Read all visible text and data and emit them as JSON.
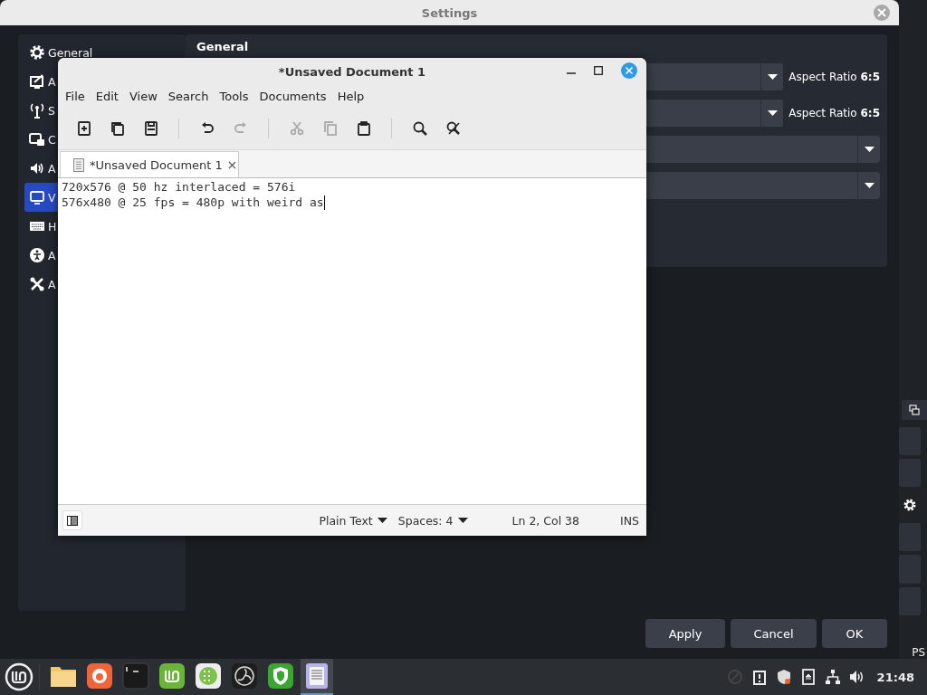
{
  "settings_window": {
    "title": "Settings",
    "sidebar": [
      {
        "label": "General",
        "kind": "gear",
        "selected": false
      },
      {
        "label": "A",
        "kind": "appearance",
        "selected": false
      },
      {
        "label": "S",
        "kind": "antenna",
        "selected": false
      },
      {
        "label": "C",
        "kind": "output",
        "selected": false
      },
      {
        "label": "A",
        "kind": "audio",
        "selected": false
      },
      {
        "label": "V",
        "kind": "monitor",
        "selected": true
      },
      {
        "label": "H",
        "kind": "keyboard",
        "selected": false
      },
      {
        "label": "A",
        "kind": "accessibility",
        "selected": false
      },
      {
        "label": "A",
        "kind": "tools",
        "selected": false
      }
    ],
    "heading": "General",
    "dropdowns": [
      {
        "kind": "short",
        "aside": "Aspect Ratio **6:5**"
      },
      {
        "kind": "short",
        "aside": "Aspect Ratio **6:5**"
      },
      {
        "kind": "wide"
      },
      {
        "kind": "wide"
      }
    ],
    "buttons": [
      "Apply",
      "Cancel",
      "OK"
    ]
  },
  "background_window": {
    "status_text": "PS"
  },
  "editor_window": {
    "title": "*Unsaved Document 1",
    "menu": [
      "File",
      "Edit",
      "View",
      "Search",
      "Tools",
      "Documents",
      "Help"
    ],
    "toolbar": [
      {
        "kind": "new",
        "disabled": false
      },
      {
        "kind": "open",
        "disabled": false
      },
      {
        "kind": "save",
        "disabled": false
      },
      {
        "kind": "sep"
      },
      {
        "kind": "undo",
        "disabled": false
      },
      {
        "kind": "redo",
        "disabled": true
      },
      {
        "kind": "sep"
      },
      {
        "kind": "cut",
        "disabled": true
      },
      {
        "kind": "copy",
        "disabled": true
      },
      {
        "kind": "paste",
        "disabled": false
      },
      {
        "kind": "sep"
      },
      {
        "kind": "find",
        "disabled": false
      },
      {
        "kind": "replace",
        "disabled": false
      }
    ],
    "tab": {
      "label": "*Unsaved Document 1",
      "selected": true
    },
    "lines": [
      "720x576 @ 50 hz interlaced = 576i",
      "576x480 @ 25 fps = 480p with weird as"
    ],
    "status": {
      "language": "Plain Text",
      "indent": "Spaces: 4",
      "position": "Ln 2, Col 38",
      "mode": "INS"
    }
  },
  "taskbar": {
    "launchers": [
      {
        "kind": "files",
        "active": false
      },
      {
        "kind": "browser",
        "active": false
      },
      {
        "kind": "terminal",
        "active": false
      },
      {
        "kind": "software",
        "active": false
      },
      {
        "kind": "apps",
        "active": false
      },
      {
        "kind": "recorder",
        "active": false
      },
      {
        "kind": "shield",
        "active": false
      },
      {
        "kind": "editor",
        "active": true
      }
    ],
    "tray": [
      {
        "kind": "blocked"
      },
      {
        "kind": "clipboard"
      },
      {
        "kind": "shield"
      },
      {
        "kind": "eject"
      },
      {
        "kind": "network"
      },
      {
        "kind": "volume"
      }
    ],
    "clock": "21:48"
  }
}
